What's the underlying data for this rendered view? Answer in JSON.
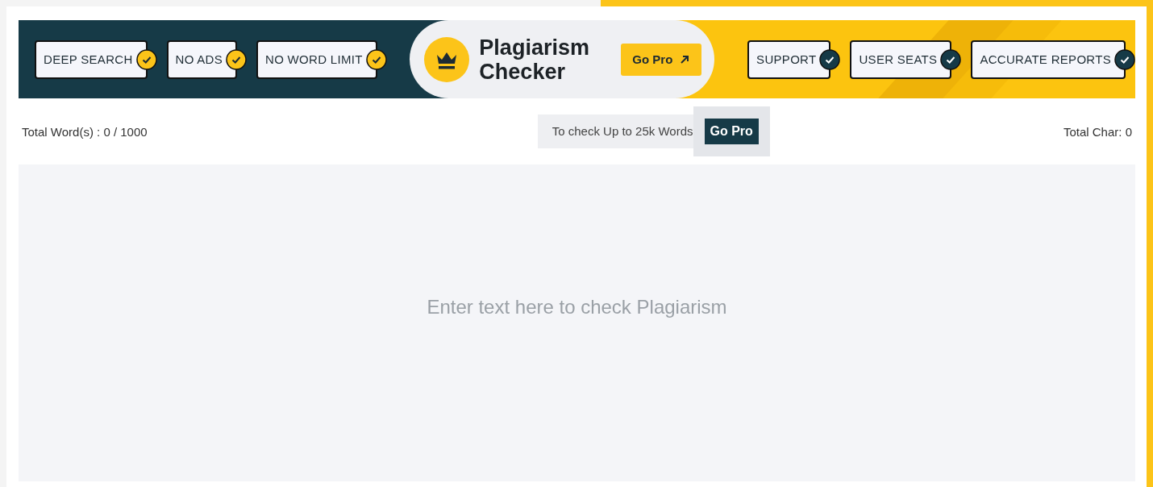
{
  "banner": {
    "features_left": [
      {
        "label": "DEEP SEARCH",
        "checked": true
      },
      {
        "label": "NO ADS",
        "checked": true
      },
      {
        "label": "NO WORD LIMIT",
        "checked": true
      }
    ],
    "title": "Plagiarism Checker",
    "pro_button": "Go Pro",
    "features_right": [
      {
        "label": "SUPPORT",
        "checked": true
      },
      {
        "label": "USER SEATS",
        "checked": true
      },
      {
        "label": "ACCURATE REPORTS",
        "checked": true
      }
    ]
  },
  "toolbar": {
    "word_count": "Total Word(s) : 0 / 1000",
    "promo_text": "To check Up to 25k Words",
    "promo_button": "Go Pro",
    "char_count": "Total Char: 0"
  },
  "editor": {
    "placeholder": "Enter text here to check Plagiarism"
  }
}
